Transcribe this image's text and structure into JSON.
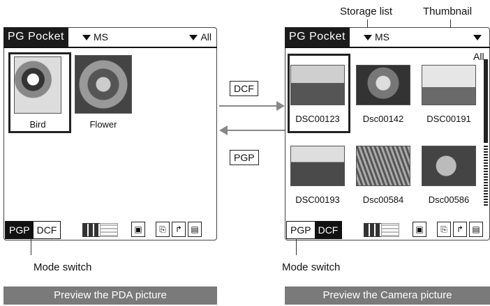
{
  "callouts": {
    "storage_list": "Storage list",
    "thumbnail": "Thumbnail",
    "mode_switch_left": "Mode switch",
    "mode_switch_right": "Mode switch"
  },
  "middle": {
    "dcf_tag": "DCF",
    "pgp_tag": "PGP"
  },
  "left_screen": {
    "app_name": "PG Pocket",
    "storage": "MS",
    "filter": "All",
    "thumbnails": [
      {
        "label": "Bird",
        "icon": "bird-image"
      },
      {
        "label": "Flower",
        "icon": "flower-image"
      }
    ],
    "mode_pgp": "PGP",
    "mode_dcf": "DCF",
    "active_mode": "PGP"
  },
  "right_screen": {
    "app_name": "PG Pocket",
    "storage": "MS",
    "filter": "All",
    "thumbnails": [
      {
        "label": "DSC00123",
        "icon": "road-image"
      },
      {
        "label": "Dsc00142",
        "icon": "flower-image"
      },
      {
        "label": "DSC00191",
        "icon": "tree-image"
      },
      {
        "label": "DSC00193",
        "icon": "landscape-image"
      },
      {
        "label": "Dsc00584",
        "icon": "grass-image"
      },
      {
        "label": "Dsc00586",
        "icon": "leaves-image"
      }
    ],
    "mode_pgp": "PGP",
    "mode_dcf": "DCF",
    "active_mode": "DCF"
  },
  "banners": {
    "left": "Preview the PDA picture",
    "right": "Preview the Camera picture"
  },
  "colors": {
    "banner": "#7a7a7a",
    "arrow": "#888888",
    "dark": "#111111"
  }
}
